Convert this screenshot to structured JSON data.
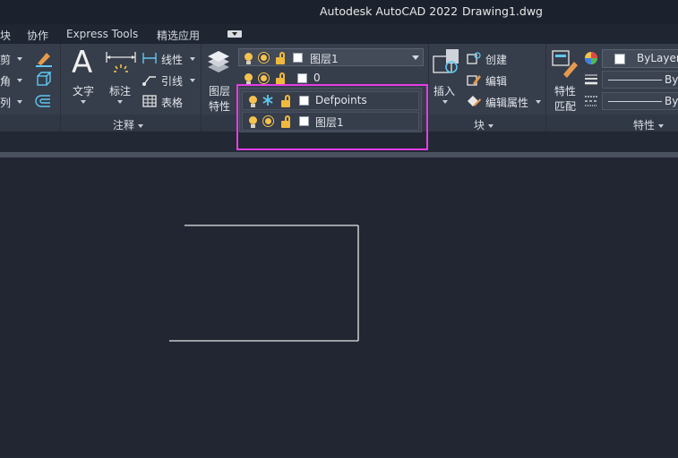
{
  "window": {
    "app_title": "Autodesk AutoCAD 2022",
    "document_title": "Drawing1.dwg"
  },
  "tabs": [
    {
      "label": "块"
    },
    {
      "label": "协作"
    },
    {
      "label": "Express Tools"
    },
    {
      "label": "精选应用"
    }
  ],
  "ribbon": {
    "modify_partial": {
      "items": [
        {
          "label": "剪"
        },
        {
          "label": "角"
        },
        {
          "label": "列"
        }
      ]
    },
    "annotation": {
      "text_label": "文字",
      "dim_label": "标注",
      "linetype_label": "线性",
      "leader_label": "引线",
      "table_label": "表格",
      "panel_label": "注释"
    },
    "layers": {
      "properties_label_1": "图层",
      "properties_label_2": "特性",
      "current_layer": "图层1",
      "row_0_name": "0",
      "dropdown_items": [
        {
          "name": "Defpoints"
        },
        {
          "name": "图层1"
        }
      ]
    },
    "block": {
      "insert_label": "插入",
      "create_label": "创建",
      "edit_label": "编辑",
      "edit_attr_label": "编辑属性",
      "panel_label": "块"
    },
    "properties": {
      "match_label_1": "特性",
      "match_label_2": "匹配",
      "color_value": "ByLayer",
      "linetype_value": "ByL",
      "lineweight_value": "ByL",
      "panel_label": "特性"
    }
  },
  "colors": {
    "highlight": "#e63de6",
    "bulb": "#f3c24f",
    "freeze": "#5ec8f0"
  }
}
